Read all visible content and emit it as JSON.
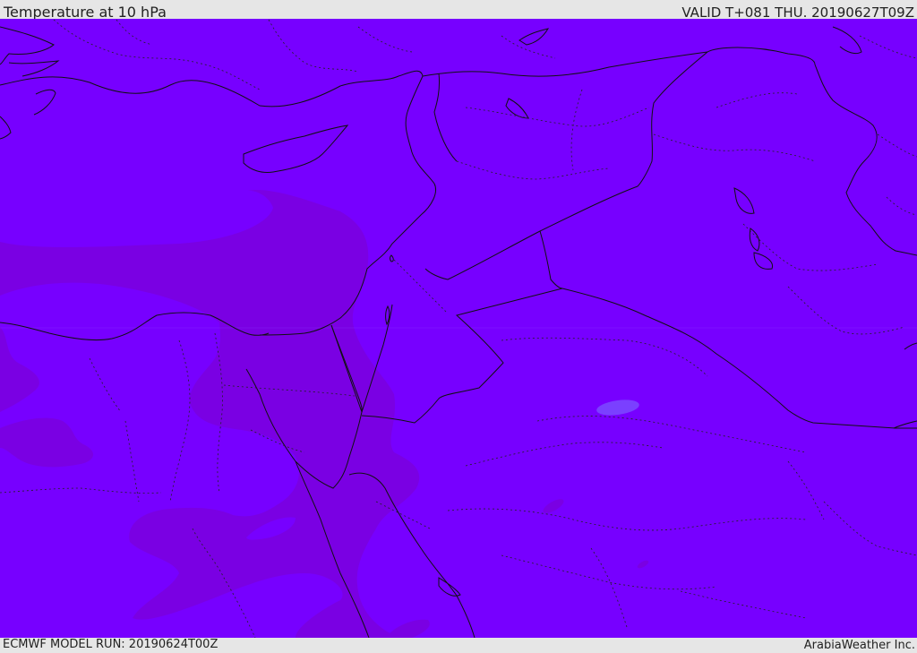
{
  "header": {
    "title": "Temperature at 10 hPa",
    "valid_time": "VALID T+081 THU. 20190627T09Z"
  },
  "footer": {
    "model_run": "ECMWF MODEL RUN: 20190624T00Z",
    "credit": "ArabiaWeather Inc."
  },
  "colors": {
    "field_main": "#7700ff",
    "field_warm": "#7a00e3",
    "field_cool": "#7a40ff",
    "border_line": "#111111",
    "frame_background": "#e6e6e6"
  }
}
